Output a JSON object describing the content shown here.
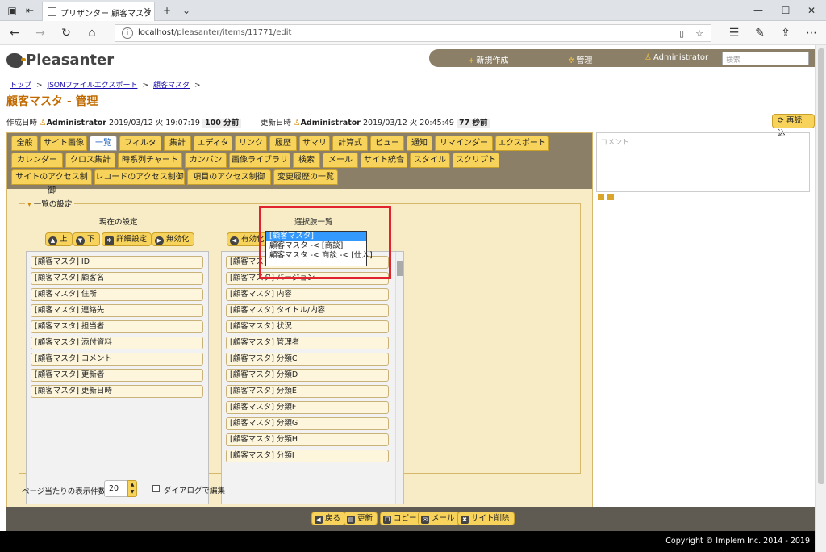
{
  "browser": {
    "tab_title": "プリザンター 顧客マスタ サ",
    "url_host": "localhost",
    "url_path": "/pleasanter/items/11771/edit"
  },
  "header": {
    "logo_text": "Pleasanter",
    "nav": {
      "new": "新規作成",
      "manage": "管理",
      "user": "Administrator",
      "search_placeholder": "検索"
    }
  },
  "breadcrumb": [
    "トップ",
    "JSONファイルエクスポート",
    "顧客マスタ"
  ],
  "page_title": "顧客マスタ - 管理",
  "meta": {
    "created_label": "作成日時",
    "created_user": "Administrator",
    "created_date": "2019/03/12 火 19:07:19",
    "created_ago": "100 分前",
    "updated_label": "更新日時",
    "updated_user": "Administrator",
    "updated_date": "2019/03/12 火 20:45:49",
    "updated_ago": "77 秒前"
  },
  "reload_label": "再読込",
  "comment_placeholder": "コメント",
  "tabs_row1": [
    "全般",
    "サイト画像",
    "一覧",
    "フィルタ",
    "集計",
    "エディタ",
    "リンク",
    "履歴",
    "サマリ",
    "計算式",
    "ビュー",
    "通知",
    "リマインダー",
    "エクスポート"
  ],
  "tabs_row2": [
    "カレンダー",
    "クロス集計",
    "時系列チャート",
    "カンバン",
    "画像ライブラリ",
    "検索",
    "メール",
    "サイト統合",
    "スタイル",
    "スクリプト"
  ],
  "tabs_row3": [
    "サイトのアクセス制御",
    "レコードのアクセス制御",
    "項目のアクセス制御",
    "変更履歴の一覧"
  ],
  "active_tab": "一覧",
  "grid_settings": {
    "legend": "一覧の設定",
    "current_title": "現在の設定",
    "choices_title": "選択肢一覧",
    "buttons": {
      "up": "上",
      "down": "下",
      "detail": "詳細設定",
      "disable": "無効化",
      "enable": "有効化"
    },
    "current_items": [
      "[顧客マスタ] ID",
      "[顧客マスタ] 顧客名",
      "[顧客マスタ] 住所",
      "[顧客マスタ] 連絡先",
      "[顧客マスタ] 担当者",
      "[顧客マスタ] 添付資料",
      "[顧客マスタ] コメント",
      "[顧客マスタ] 更新者",
      "[顧客マスタ] 更新日時"
    ],
    "choice_items": [
      "[顧客マスタ] ID",
      "[顧客マスタ] バージョン",
      "[顧客マスタ] 内容",
      "[顧客マスタ] タイトル/内容",
      "[顧客マスタ] 状況",
      "[顧客マスタ] 管理者",
      "[顧客マスタ] 分類C",
      "[顧客マスタ] 分類D",
      "[顧客マスタ] 分類E",
      "[顧客マスタ] 分類F",
      "[顧客マスタ] 分類G",
      "[顧客マスタ] 分類H",
      "[顧客マスタ] 分類I"
    ],
    "dropdown_options": [
      "[顧客マスタ]",
      "顧客マスタ -< [商談]",
      "顧客マスタ -< 商談 -< [仕入]"
    ],
    "selected_option": "[顧客マスタ]"
  },
  "page_size": {
    "label": "ページ当たりの表示件数",
    "value": "20"
  },
  "dialog_edit_label": "ダイアログで編集",
  "footer_buttons": {
    "back": "戻る",
    "update": "更新",
    "copy": "コピー",
    "mail": "メール",
    "delete": "サイト削除"
  },
  "copyright": "Copyright © Implem Inc. 2014 - 2019",
  "colors": {
    "accent": "#c26a00",
    "button": "#f7d35c",
    "tab_bar": "#8b7f68",
    "highlight": "#e0232e"
  }
}
